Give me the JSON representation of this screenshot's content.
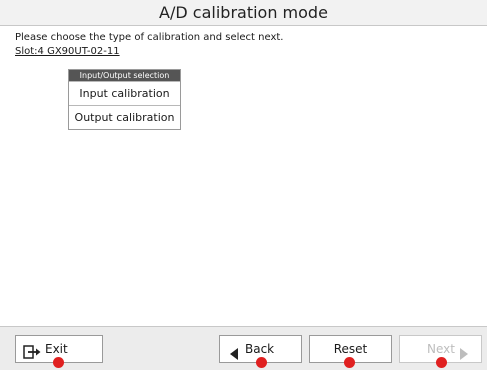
{
  "header": {
    "title": "A/D calibration mode"
  },
  "main": {
    "instruction": "Please choose the type of calibration and select next.",
    "slot": "Slot:4  GX90UT-02-11"
  },
  "selection_panel": {
    "header": "Input/Output selection",
    "items": [
      {
        "label": "Input calibration"
      },
      {
        "label": "Output calibration"
      }
    ]
  },
  "footer": {
    "exit_label": "Exit",
    "back_label": "Back",
    "reset_label": "Reset",
    "next_label": "Next",
    "next_enabled": false
  },
  "icons": {
    "exit": "exit-arrow-icon",
    "back": "triangle-left-icon",
    "next": "triangle-right-icon",
    "marker": "red-dot"
  },
  "colors": {
    "title_bar": "#f2f2f2",
    "panel_header": "#555555",
    "marker": "#e02020",
    "disabled_text": "#bdbdbd"
  }
}
